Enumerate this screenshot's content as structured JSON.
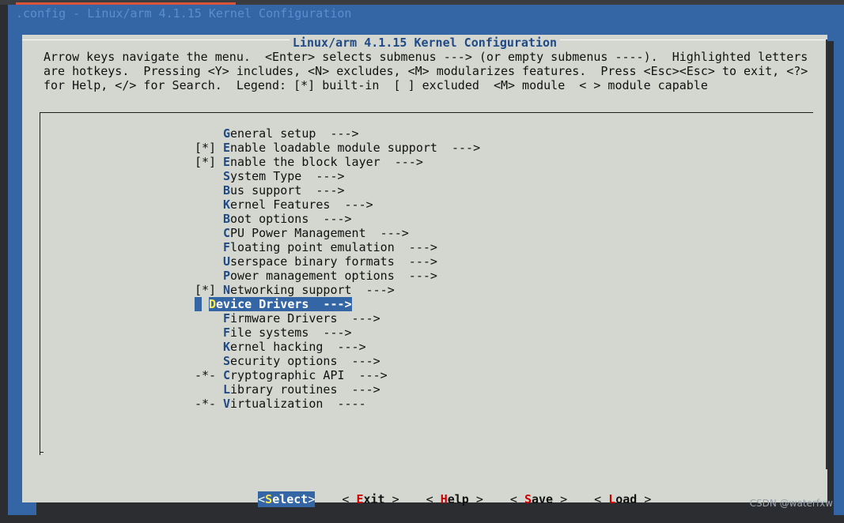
{
  "window": {
    "backtitle": ".config - Linux/arm 4.1.15 Kernel Configuration"
  },
  "dialog": {
    "title": "Linux/arm 4.1.15 Kernel Configuration",
    "help_lines": [
      "Arrow keys navigate the menu.  <Enter> selects submenus ---> (or empty submenus ----).  Highlighted letters",
      "are hotkeys.  Pressing <Y> includes, <N> excludes, <M> modularizes features.  Press <Esc><Esc> to exit, <?>",
      "for Help, </> for Search.  Legend: [*] built-in  [ ] excluded  <M> module  < > module capable"
    ]
  },
  "menu": {
    "items": [
      {
        "prefix": "",
        "hotkey": "G",
        "rest": "eneral setup",
        "arrow": "  --->"
      },
      {
        "prefix": "[*]",
        "hotkey": "E",
        "rest": "nable loadable module support",
        "arrow": "  --->"
      },
      {
        "prefix": "[*]",
        "hotkey": "E",
        "rest": "nable the block layer",
        "arrow": "  --->"
      },
      {
        "prefix": "",
        "hotkey": "S",
        "rest": "ystem Type",
        "arrow": "  --->"
      },
      {
        "prefix": "",
        "hotkey": "B",
        "rest": "us support",
        "arrow": "  --->"
      },
      {
        "prefix": "",
        "hotkey": "K",
        "rest": "ernel Features",
        "arrow": "  --->"
      },
      {
        "prefix": "",
        "hotkey": "B",
        "rest": "oot options",
        "arrow": "  --->"
      },
      {
        "prefix": "",
        "hotkey": "C",
        "rest": "PU Power Management",
        "arrow": "  --->"
      },
      {
        "prefix": "",
        "hotkey": "F",
        "rest": "loating point emulation",
        "arrow": "  --->"
      },
      {
        "prefix": "",
        "hotkey": "U",
        "rest": "serspace binary formats",
        "arrow": "  --->"
      },
      {
        "prefix": "",
        "hotkey": "P",
        "rest": "ower management options",
        "arrow": "  --->"
      },
      {
        "prefix": "[*]",
        "hotkey": "N",
        "rest": "etworking support",
        "arrow": "  --->"
      },
      {
        "prefix": "",
        "hotkey": "D",
        "rest": "evice Drivers",
        "arrow": "  --->"
      },
      {
        "prefix": "",
        "hotkey": "F",
        "rest": "irmware Drivers",
        "arrow": "  --->"
      },
      {
        "prefix": "",
        "hotkey": "F",
        "rest": "ile systems",
        "arrow": "  --->"
      },
      {
        "prefix": "",
        "hotkey": "K",
        "rest": "ernel hacking",
        "arrow": "  --->"
      },
      {
        "prefix": "",
        "hotkey": "S",
        "rest": "ecurity options",
        "arrow": "  --->"
      },
      {
        "prefix": "-*-",
        "hotkey": "C",
        "rest": "ryptographic API",
        "arrow": "  --->"
      },
      {
        "prefix": "",
        "hotkey": "L",
        "rest": "ibrary routines",
        "arrow": "  --->"
      },
      {
        "prefix": "-*-",
        "hotkey": "V",
        "rest": "irtualization",
        "arrow": "  ----"
      }
    ]
  },
  "buttons": {
    "select": {
      "hotkey": "S",
      "rest": "elect"
    },
    "exit": {
      "hotkey": "E",
      "rest": "xit"
    },
    "help": {
      "hotkey": "H",
      "rest": "elp"
    },
    "save": {
      "hotkey": "S",
      "rest": "ave"
    },
    "load": {
      "hotkey": "L",
      "rest": "oad"
    }
  },
  "watermark": "CSDN @waterfxw",
  "colors": {
    "terminal_bg": "#3465a4",
    "dialog_bg": "#d3d7cf",
    "hotkey": "#204a87",
    "selection_bg": "#3465a4",
    "button_hotkey": "#cc0000"
  }
}
